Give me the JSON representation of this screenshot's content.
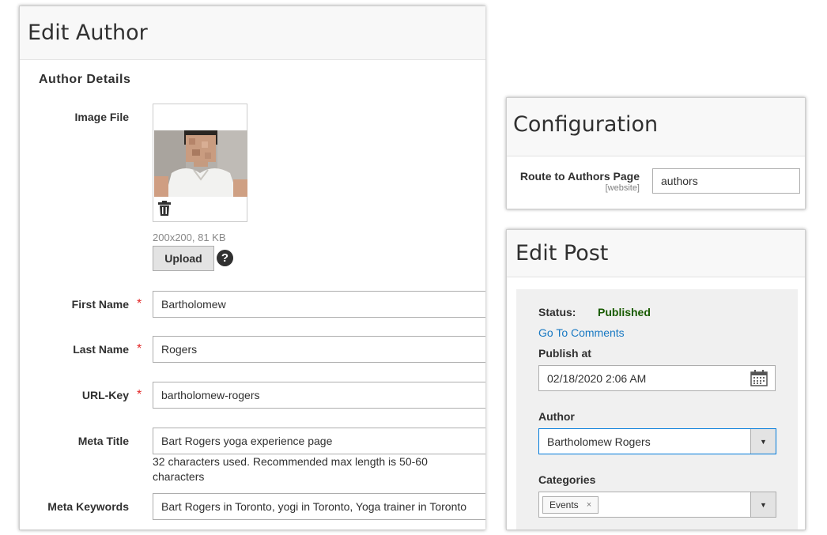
{
  "author_panel": {
    "title": "Edit Author",
    "section_title": "Author Details",
    "image_label": "Image File",
    "image_meta": "200x200, 81 KB",
    "upload_label": "Upload",
    "help_glyph": "?",
    "fields": {
      "first_name": {
        "label": "First Name",
        "value": "Bartholomew"
      },
      "last_name": {
        "label": "Last Name",
        "value": "Rogers"
      },
      "url_key": {
        "label": "URL-Key",
        "value": "bartholomew-rogers"
      },
      "meta_title": {
        "label": "Meta Title",
        "value": "Bart Rogers yoga experience page",
        "note": "32 characters used. Recommended max length is 50-60 characters"
      },
      "meta_keywords": {
        "label": "Meta Keywords",
        "value": "Bart Rogers in Toronto, yogi in Toronto, Yoga trainer in Toronto"
      }
    },
    "required_mark": "*"
  },
  "config_panel": {
    "title": "Configuration",
    "route_label": "Route to Authors Page",
    "route_scope": "[website]",
    "route_value": "authors"
  },
  "post_panel": {
    "title": "Edit Post",
    "status_label": "Status:",
    "status_value": "Published",
    "comments_link": "Go To Comments",
    "publish_label": "Publish at",
    "publish_value": "02/18/2020 2:06 AM",
    "author_label": "Author",
    "author_value": "Bartholomew Rogers",
    "categories_label": "Categories",
    "category_chip": "Events",
    "chip_remove": "×",
    "arrow_glyph": "▼"
  },
  "icons": {
    "trash": "trash-icon",
    "help": "help-icon",
    "calendar": "calendar-icon",
    "dropdown": "chevron-down-icon"
  },
  "colors": {
    "required": "#e22626",
    "status_published": "#185b00",
    "link": "#1979c3",
    "focus_border": "#007bdb"
  }
}
